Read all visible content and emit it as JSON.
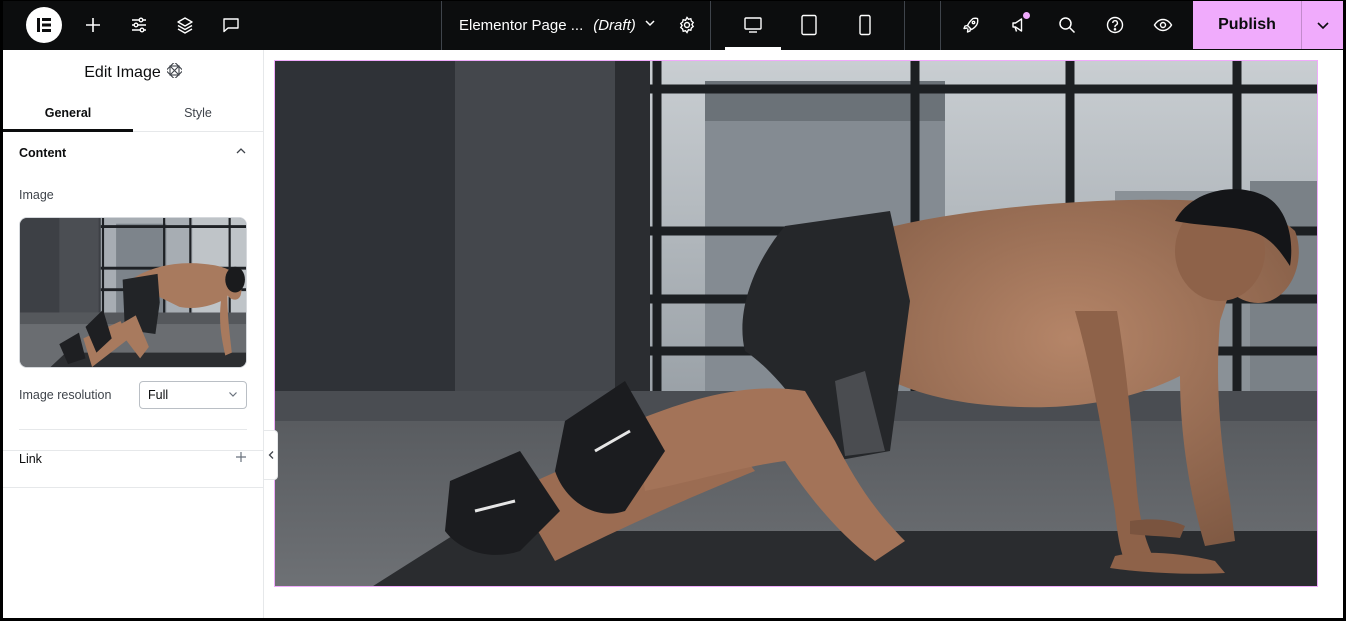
{
  "topbar": {
    "page_name": "Elementor Page ...",
    "page_status": "(Draft)",
    "publish_label": "Publish",
    "accent": "#f0abfc",
    "bg": "#0c0d0e",
    "icons": [
      "elementor-logo-icon",
      "add-element-icon",
      "site-settings-icon",
      "structure-layers-icon",
      "comments-icon",
      "page-settings-icon",
      "desktop-icon",
      "tablet-icon",
      "mobile-icon",
      "launchpad-rocket-icon",
      "notifications-megaphone-icon",
      "finder-search-icon",
      "help-icon",
      "preview-eye-icon"
    ]
  },
  "panel": {
    "title": "Edit Image",
    "tabs": [
      {
        "label": "General",
        "active": true
      },
      {
        "label": "Style",
        "active": false
      }
    ],
    "content_section": {
      "label": "Content",
      "image_label": "Image",
      "resolution_label": "Image resolution",
      "resolution_value": "Full"
    },
    "link_section": {
      "label": "Link"
    }
  }
}
